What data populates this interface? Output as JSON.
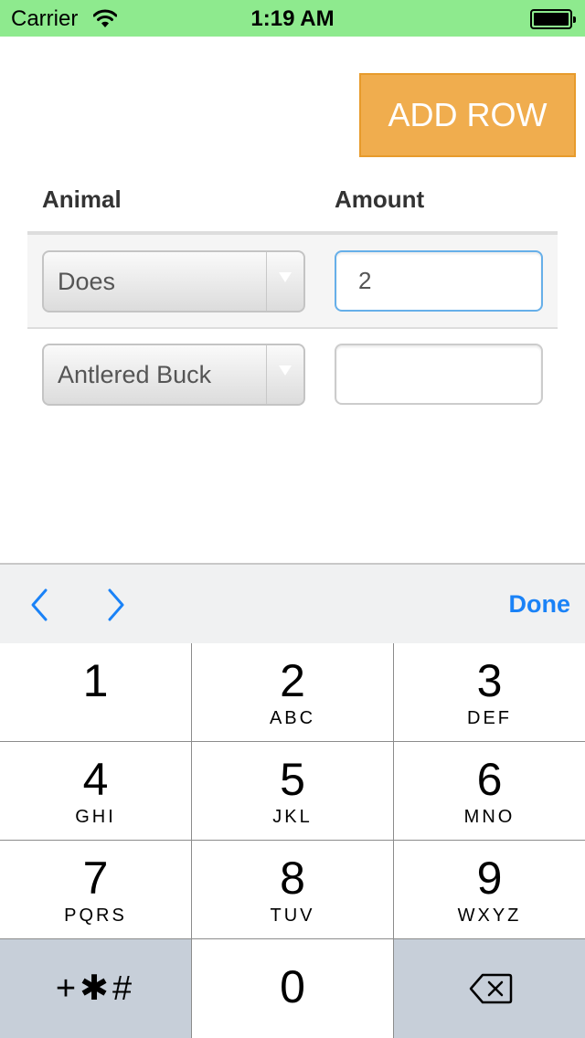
{
  "status_bar": {
    "carrier": "Carrier",
    "time": "1:19 AM"
  },
  "actions": {
    "add_row_label": "ADD ROW"
  },
  "table": {
    "headers": {
      "animal": "Animal",
      "amount": "Amount"
    },
    "rows": [
      {
        "animal": "Does",
        "amount": "2"
      },
      {
        "animal": "Antlered Buck",
        "amount": ""
      }
    ]
  },
  "toolbar": {
    "done_label": "Done"
  },
  "keypad": {
    "keys": [
      {
        "digit": "1",
        "letters": ""
      },
      {
        "digit": "2",
        "letters": "ABC"
      },
      {
        "digit": "3",
        "letters": "DEF"
      },
      {
        "digit": "4",
        "letters": "GHI"
      },
      {
        "digit": "5",
        "letters": "JKL"
      },
      {
        "digit": "6",
        "letters": "MNO"
      },
      {
        "digit": "7",
        "letters": "PQRS"
      },
      {
        "digit": "8",
        "letters": "TUV"
      },
      {
        "digit": "9",
        "letters": "WXYZ"
      },
      {
        "digit": "0",
        "letters": ""
      }
    ],
    "symbols": "+✱#"
  },
  "colors": {
    "status_bar_bg": "#8eea8e",
    "accent_orange": "#f0ad4e",
    "focus_blue": "#66afe9",
    "toolbar_tint": "#1a82f7"
  }
}
